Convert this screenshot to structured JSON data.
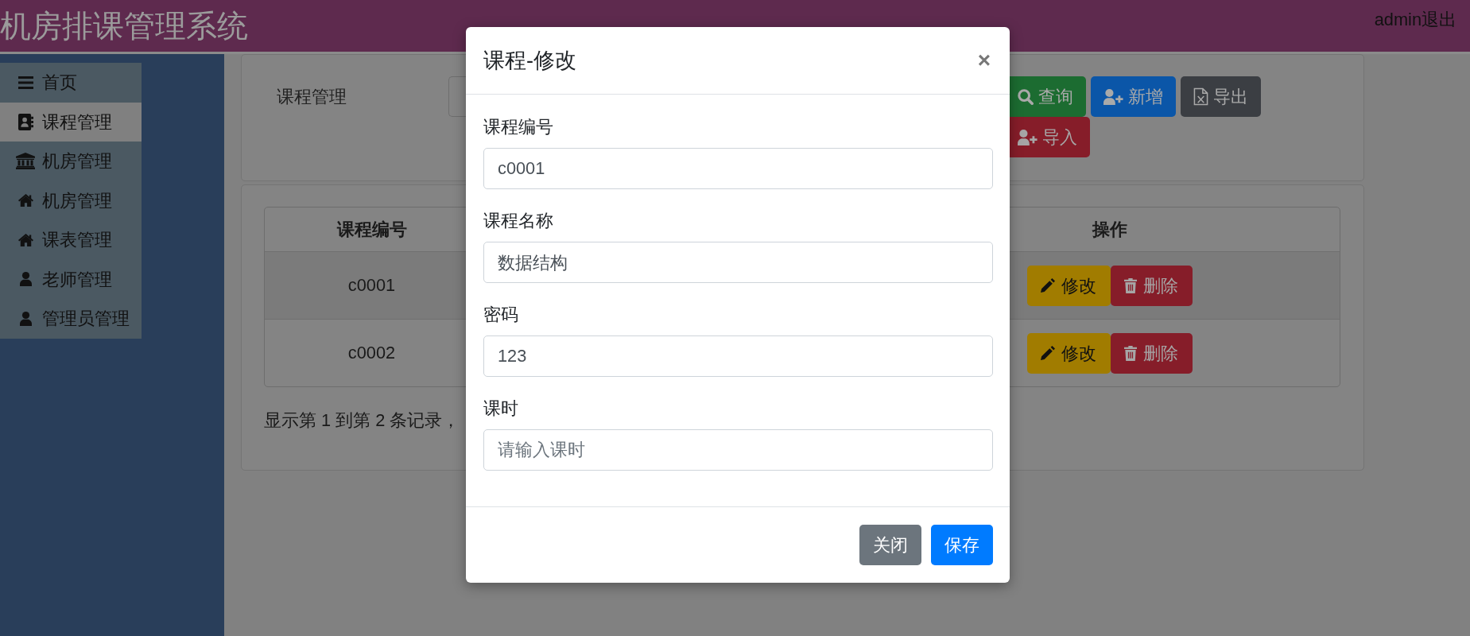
{
  "header": {
    "title": "机房排课管理系统",
    "user": "admin",
    "logout": "退出"
  },
  "sidebar": {
    "items": [
      {
        "label": "首页",
        "kind": "menu",
        "selected": false
      },
      {
        "label": "课程管理",
        "kind": "contact",
        "selected": true
      },
      {
        "label": "机房管理",
        "kind": "institution",
        "selected": false
      },
      {
        "label": "机房管理",
        "kind": "home",
        "selected": false
      },
      {
        "label": "课表管理",
        "kind": "home",
        "selected": false
      },
      {
        "label": "老师管理",
        "kind": "user",
        "selected": false
      },
      {
        "label": "管理员管理",
        "kind": "user",
        "selected": false
      }
    ]
  },
  "search_panel": {
    "label": "课程管理",
    "buttons": [
      {
        "label": "查询",
        "kind": "search"
      },
      {
        "label": "新增",
        "kind": "add"
      },
      {
        "label": "导出",
        "kind": "export"
      },
      {
        "label": "导入",
        "kind": "import"
      }
    ]
  },
  "table": {
    "columns": [
      {
        "label": "课程编号",
        "kind": "text"
      },
      {
        "label": "操作",
        "kind": "actions"
      }
    ],
    "rows": [
      {
        "cells": [
          "c0001"
        ],
        "actions": [
          {
            "label": "修改",
            "kind": "edit"
          },
          {
            "label": "删除",
            "kind": "delete"
          }
        ]
      },
      {
        "cells": [
          "c0002"
        ],
        "actions": [
          {
            "label": "修改",
            "kind": "edit"
          },
          {
            "label": "删除",
            "kind": "delete"
          }
        ]
      }
    ]
  },
  "pagination_info": "显示第 1 到第 2 条记录，",
  "modal": {
    "title": "课程-修改",
    "close": "×",
    "fields": [
      {
        "label": "课程编号",
        "value": "c0001"
      },
      {
        "label": "课程名称",
        "value": "数据结构"
      },
      {
        "label": "密码",
        "value": "123"
      },
      {
        "label": "课时",
        "placeholder": "请输入课时"
      }
    ],
    "buttons": [
      {
        "label": "关闭",
        "kind": "secondary"
      },
      {
        "label": "保存",
        "kind": "primary"
      }
    ]
  }
}
